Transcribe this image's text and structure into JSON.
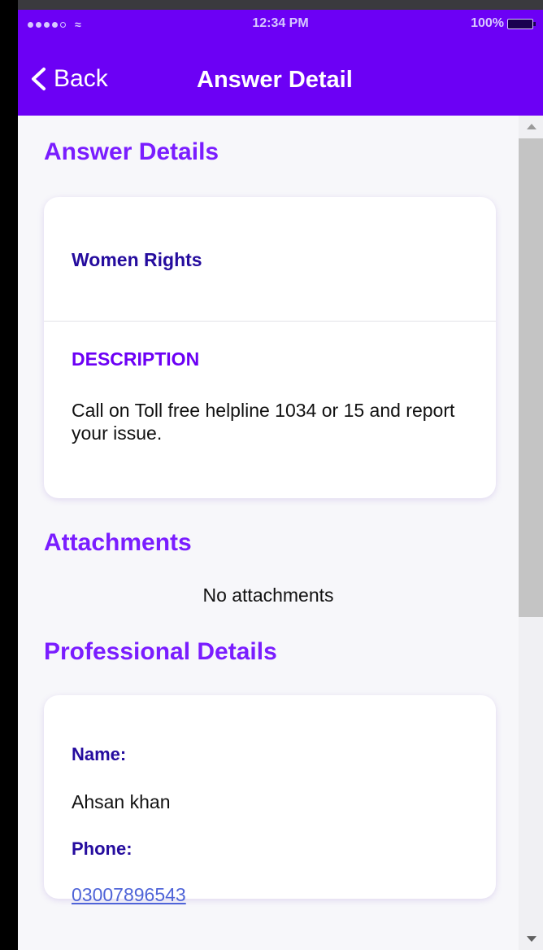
{
  "status_bar": {
    "time": "12:34 PM",
    "battery": "100%"
  },
  "nav": {
    "back_label": "Back",
    "title": "Answer Detail"
  },
  "answer": {
    "section_title": "Answer Details",
    "topic": "Women Rights",
    "description_label": "DESCRIPTION",
    "description_text": "Call on Toll free helpline 1034 or 15 and report your issue."
  },
  "attachments": {
    "section_title": "Attachments",
    "empty_text": "No attachments"
  },
  "professional": {
    "section_title": "Professional Details",
    "name_label": "Name:",
    "name_value": "Ahsan khan",
    "phone_label": "Phone:",
    "phone_value": "03007896543"
  },
  "colors": {
    "brand": "#6c00f5",
    "heading": "#7a1dff",
    "label": "#250c9e",
    "link": "#4f64d8"
  },
  "icons": {
    "back": "chevron-left-icon",
    "wifi": "wifi-icon",
    "battery": "battery-icon",
    "signal": "signal-icon"
  }
}
